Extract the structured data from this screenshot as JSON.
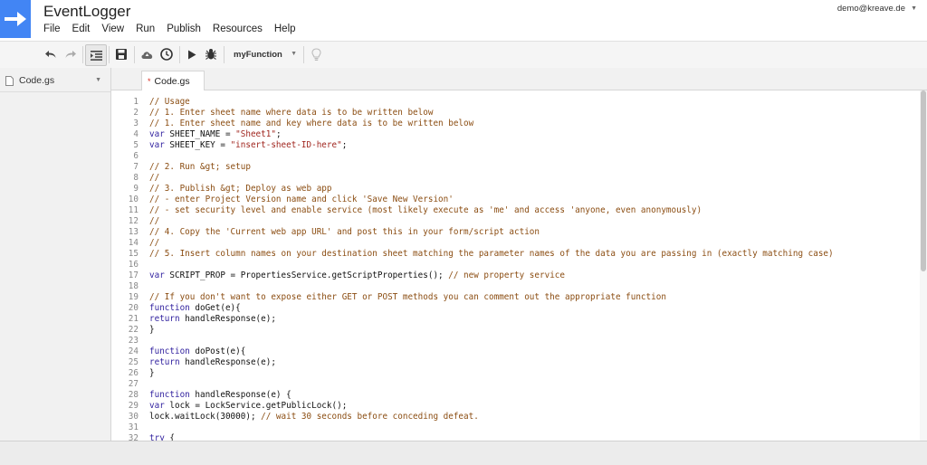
{
  "app": {
    "title": "EventLogger",
    "account": "demo@kreave.de"
  },
  "menu": [
    "File",
    "Edit",
    "View",
    "Run",
    "Publish",
    "Resources",
    "Help"
  ],
  "toolbar": {
    "function_select": "myFunction"
  },
  "sidebar": {
    "files": [
      {
        "name": "Code.gs"
      }
    ]
  },
  "tabs": [
    {
      "label": "Code.gs",
      "modified_marker": "*"
    }
  ],
  "editor": {
    "lines": [
      [
        [
          "c",
          "// Usage"
        ]
      ],
      [
        [
          "c",
          "// 1. Enter sheet name where data is to be written below"
        ]
      ],
      [
        [
          "c",
          "// 1. Enter sheet name and key where data is to be written below"
        ]
      ],
      [
        [
          "k",
          "var"
        ],
        [
          "p",
          " SHEET_NAME = "
        ],
        [
          "s",
          "\"Sheet1\""
        ],
        [
          "p",
          ";"
        ]
      ],
      [
        [
          "k",
          "var"
        ],
        [
          "p",
          " SHEET_KEY = "
        ],
        [
          "s",
          "\"insert-sheet-ID-here\""
        ],
        [
          "p",
          ";"
        ]
      ],
      [],
      [
        [
          "c",
          "// 2. Run &gt; setup"
        ]
      ],
      [
        [
          "c",
          "//"
        ]
      ],
      [
        [
          "c",
          "// 3. Publish &gt; Deploy as web app"
        ]
      ],
      [
        [
          "c",
          "// - enter Project Version name and click 'Save New Version'"
        ]
      ],
      [
        [
          "c",
          "// - set security level and enable service (most likely execute as 'me' and access 'anyone, even anonymously)"
        ]
      ],
      [
        [
          "c",
          "//"
        ]
      ],
      [
        [
          "c",
          "// 4. Copy the 'Current web app URL' and post this in your form/script action"
        ]
      ],
      [
        [
          "c",
          "//"
        ]
      ],
      [
        [
          "c",
          "// 5. Insert column names on your destination sheet matching the parameter names of the data you are passing in (exactly matching case)"
        ]
      ],
      [],
      [
        [
          "k",
          "var"
        ],
        [
          "p",
          " SCRIPT_PROP = PropertiesService.getScriptProperties(); "
        ],
        [
          "c",
          "// new property service"
        ]
      ],
      [],
      [
        [
          "c",
          "// If you don't want to expose either GET or POST methods you can comment out the appropriate function"
        ]
      ],
      [
        [
          "k",
          "function"
        ],
        [
          "p",
          " doGet(e){"
        ]
      ],
      [
        [
          "k",
          "return"
        ],
        [
          "p",
          " handleResponse(e);"
        ]
      ],
      [
        [
          "p",
          "}"
        ]
      ],
      [],
      [
        [
          "k",
          "function"
        ],
        [
          "p",
          " doPost(e){"
        ]
      ],
      [
        [
          "k",
          "return"
        ],
        [
          "p",
          " handleResponse(e);"
        ]
      ],
      [
        [
          "p",
          "}"
        ]
      ],
      [],
      [
        [
          "k",
          "function"
        ],
        [
          "p",
          " handleResponse(e) {"
        ]
      ],
      [
        [
          "k",
          "var"
        ],
        [
          "p",
          " lock = LockService.getPublicLock();"
        ]
      ],
      [
        [
          "p",
          "lock.waitLock(30000); "
        ],
        [
          "c",
          "// wait 30 seconds before conceding defeat."
        ]
      ],
      [],
      [
        [
          "k",
          "try"
        ],
        [
          "p",
          " {"
        ]
      ]
    ]
  }
}
